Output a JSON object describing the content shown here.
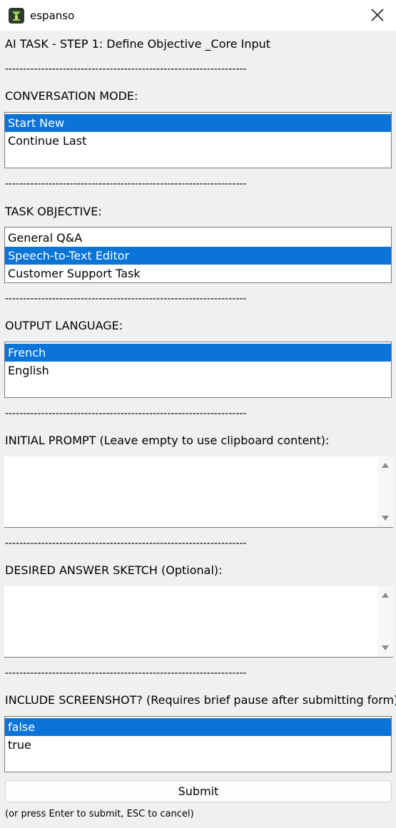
{
  "window": {
    "title": "espanso",
    "icon": "espanso-icon",
    "close_icon": "close-icon"
  },
  "form": {
    "heading": "AI TASK - STEP 1: Define Objective _Core Input",
    "separator": "-------------------------------------------------------------------",
    "conversation_mode": {
      "label": "CONVERSATION MODE:",
      "options": [
        "Start New",
        "Continue Last"
      ],
      "selected": "Start New"
    },
    "task_objective": {
      "label": "TASK OBJECTIVE:",
      "options": [
        "General Q&A",
        "Speech-to-Text Editor",
        "Customer Support Task"
      ],
      "selected": "Speech-to-Text Editor"
    },
    "output_language": {
      "label": "OUTPUT LANGUAGE:",
      "options": [
        "French",
        "English"
      ],
      "selected": "French"
    },
    "initial_prompt": {
      "label": "INITIAL PROMPT (Leave empty to use clipboard content):",
      "value": ""
    },
    "desired_answer": {
      "label": "DESIRED ANSWER SKETCH (Optional):",
      "value": ""
    },
    "include_screenshot": {
      "label": "INCLUDE SCREENSHOT? (Requires brief pause after submitting form)",
      "options": [
        "false",
        "true"
      ],
      "selected": "false"
    },
    "submit_label": "Submit",
    "hint": "(or press Enter to submit, ESC to cancel)"
  },
  "colors": {
    "selection": "#0a74d9",
    "background": "#f0f0f0"
  }
}
